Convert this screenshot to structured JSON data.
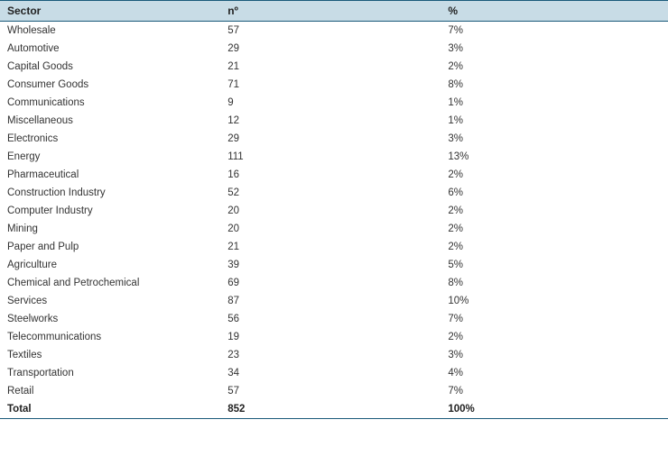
{
  "chart_data": {
    "type": "table",
    "title": "",
    "columns": [
      "Sector",
      "nº",
      "%"
    ],
    "rows": [
      {
        "sector": "Wholesale",
        "n": 57,
        "pct": "7%"
      },
      {
        "sector": "Automotive",
        "n": 29,
        "pct": "3%"
      },
      {
        "sector": "Capital Goods",
        "n": 21,
        "pct": "2%"
      },
      {
        "sector": "Consumer Goods",
        "n": 71,
        "pct": "8%"
      },
      {
        "sector": "Communications",
        "n": 9,
        "pct": "1%"
      },
      {
        "sector": "Miscellaneous",
        "n": 12,
        "pct": "1%"
      },
      {
        "sector": "Electronics",
        "n": 29,
        "pct": "3%"
      },
      {
        "sector": "Energy",
        "n": 111,
        "pct": "13%"
      },
      {
        "sector": "Pharmaceutical",
        "n": 16,
        "pct": "2%"
      },
      {
        "sector": "Construction Industry",
        "n": 52,
        "pct": "6%"
      },
      {
        "sector": "Computer Industry",
        "n": 20,
        "pct": "2%"
      },
      {
        "sector": "Mining",
        "n": 20,
        "pct": "2%"
      },
      {
        "sector": "Paper and Pulp",
        "n": 21,
        "pct": "2%"
      },
      {
        "sector": "Agriculture",
        "n": 39,
        "pct": "5%"
      },
      {
        "sector": "Chemical and Petrochemical",
        "n": 69,
        "pct": "8%"
      },
      {
        "sector": "Services",
        "n": 87,
        "pct": "10%"
      },
      {
        "sector": "Steelworks",
        "n": 56,
        "pct": "7%"
      },
      {
        "sector": "Telecommunications",
        "n": 19,
        "pct": "2%"
      },
      {
        "sector": "Textiles",
        "n": 23,
        "pct": "3%"
      },
      {
        "sector": "Transportation",
        "n": 34,
        "pct": "4%"
      },
      {
        "sector": "Retail",
        "n": 57,
        "pct": "7%"
      }
    ],
    "total": {
      "sector": "Total",
      "n": 852,
      "pct": "100%"
    }
  },
  "headers": {
    "sector": "Sector",
    "n": "nº",
    "pct": "%"
  }
}
